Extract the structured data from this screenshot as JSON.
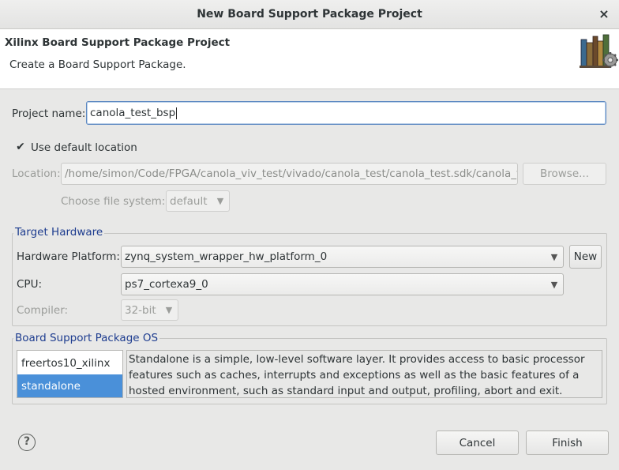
{
  "window": {
    "title": "New Board Support Package Project",
    "close_glyph": "×"
  },
  "banner": {
    "title": "Xilinx Board Support Package Project",
    "description": "Create a Board Support Package.",
    "icon": "books-gear-icon"
  },
  "project": {
    "name_label": "Project name:",
    "name_value": "canola_test_bsp"
  },
  "location": {
    "use_default_label": "Use default location",
    "use_default_checked": true,
    "check_glyph": "✔",
    "location_label": "Location:",
    "location_value": "/home/simon/Code/FPGA/canola_viv_test/vivado/canola_test/canola_test.sdk/canola_tes",
    "browse_label": "Browse...",
    "fs_label": "Choose file system:",
    "fs_value": "default"
  },
  "target_hardware": {
    "title": "Target Hardware",
    "platform_label": "Hardware Platform:",
    "platform_value": "zynq_system_wrapper_hw_platform_0",
    "new_label": "New",
    "cpu_label": "CPU:",
    "cpu_value": "ps7_cortexa9_0",
    "compiler_label": "Compiler:",
    "compiler_value": "32-bit"
  },
  "bsp_os": {
    "title": "Board Support Package OS",
    "items": [
      {
        "label": "freertos10_xilinx",
        "selected": false
      },
      {
        "label": "standalone",
        "selected": true
      }
    ],
    "description": "Standalone is a simple, low-level software layer. It provides access to basic processor features such as caches, interrupts and exceptions as well as the basic features of a hosted environment, such as standard input and output, profiling, abort and exit."
  },
  "footer": {
    "help_glyph": "?",
    "cancel_label": "Cancel",
    "finish_label": "Finish"
  },
  "icons": {
    "dropdown": "chevron-down-icon"
  },
  "colors": {
    "accent": "#4a90d9",
    "group_title": "#1d3c8f"
  }
}
